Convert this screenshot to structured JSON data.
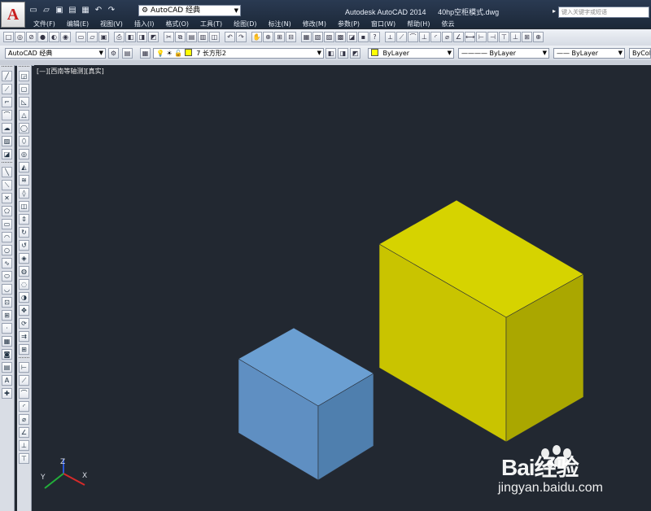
{
  "title_bar": {
    "app_logo": "A",
    "workspace": "AutoCAD 经典",
    "app_name": "Autodesk AutoCAD 2014",
    "file_name": "40hp空柜模式.dwg",
    "search_placeholder": "键入关键字或短语"
  },
  "menu": [
    "文件(F)",
    "编辑(E)",
    "视图(V)",
    "插入(I)",
    "格式(O)",
    "工具(T)",
    "绘图(D)",
    "标注(N)",
    "修改(M)",
    "参数(P)",
    "窗口(W)",
    "帮助(H)",
    "依云"
  ],
  "toolbar2": {
    "workspace": "AutoCAD 经典",
    "layer": "7  长方形2",
    "color": "ByLayer",
    "linetype": "ByLayer",
    "lineweight": "ByLayer",
    "plotstyle": "ByCol"
  },
  "viewport": {
    "label": "[—][西南等轴测][真实]"
  },
  "scene": {
    "colors": {
      "background": "#222831",
      "blue_top": "#6b9fd2",
      "blue_left": "#5f8fc2",
      "blue_right": "#4f7fae",
      "yellow_top": "#d6d300",
      "yellow_left": "#c9c400",
      "yellow_right": "#aaa700"
    }
  },
  "ucs": {
    "x_label": "X",
    "y_label": "Y",
    "z_label": "Z"
  },
  "watermark": {
    "brand": "Bai经验",
    "url": "jingyan.baidu.com"
  }
}
